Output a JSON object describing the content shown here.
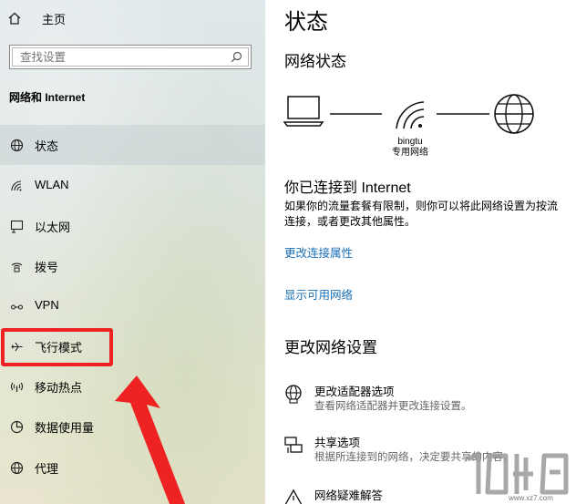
{
  "sidebar": {
    "home_label": "主页",
    "search_placeholder": "查找设置",
    "section_title": "网络和 Internet",
    "items": [
      {
        "label": "状态",
        "icon": "globe-icon"
      },
      {
        "label": "WLAN",
        "icon": "wifi-icon"
      },
      {
        "label": "以太网",
        "icon": "ethernet-icon"
      },
      {
        "label": "拨号",
        "icon": "dialup-icon"
      },
      {
        "label": "VPN",
        "icon": "vpn-icon"
      },
      {
        "label": "飞行模式",
        "icon": "airplane-icon"
      },
      {
        "label": "移动热点",
        "icon": "hotspot-icon"
      },
      {
        "label": "数据使用量",
        "icon": "data-usage-icon"
      },
      {
        "label": "代理",
        "icon": "proxy-globe-icon"
      }
    ],
    "selected_index": 0
  },
  "main": {
    "title": "状态",
    "network_status_heading": "网络状态",
    "network_name": "bingtu",
    "network_type": "专用网络",
    "connected_heading": "你已连接到 Internet",
    "connected_desc_line1": "如果你的流量套餐有限制，则你可以将此网络设置为按流",
    "connected_desc_line2": "连接，或者更改其他属性。",
    "link_change_props": "更改连接属性",
    "link_show_networks": "显示可用网络",
    "change_settings_heading": "更改网络设置",
    "options": [
      {
        "title": "更改适配器选项",
        "desc": "查看网络适配器并更改连接设置。",
        "icon": "adapter-globe-icon"
      },
      {
        "title": "共享选项",
        "desc": "根据所连接到的网络，决定要共享的内容。",
        "icon": "sharing-icon"
      },
      {
        "title": "网络疑难解答",
        "desc": "",
        "icon": "warning-icon"
      }
    ]
  },
  "annotation": {
    "box_color": "#ee2222",
    "arrow_color": "#ee2222"
  },
  "watermark": {
    "url": "www.xz7.com"
  },
  "colors": {
    "link": "#1a6fb5",
    "sidebar_selected": "#c8d2d4"
  }
}
